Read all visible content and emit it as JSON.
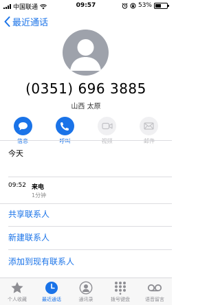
{
  "status_bar": {
    "carrier": "中国联通",
    "time": "09:57",
    "battery": "53%",
    "battery_level": 0.53
  },
  "nav": {
    "back_label": "最近通话"
  },
  "contact": {
    "phone_number": "(0351) 696 3885",
    "location": "山西 太原"
  },
  "actions": [
    {
      "label": "信息",
      "icon": "message-icon",
      "enabled": true
    },
    {
      "label": "呼叫",
      "icon": "phone-icon",
      "enabled": true
    },
    {
      "label": "视频",
      "icon": "video-icon",
      "enabled": false
    },
    {
      "label": "邮件",
      "icon": "mail-icon",
      "enabled": false
    }
  ],
  "recents": {
    "header": "今天",
    "time": "09:52",
    "type": "来电",
    "duration": "1分钟"
  },
  "options": [
    {
      "label": "共享联系人"
    },
    {
      "label": "新建联系人"
    },
    {
      "label": "添加到现有联系人"
    }
  ],
  "tabs": [
    {
      "label": "个人收藏",
      "icon": "star-icon",
      "selected": false
    },
    {
      "label": "最近通话",
      "icon": "clock-icon",
      "selected": true
    },
    {
      "label": "通讯录",
      "icon": "contacts-icon",
      "selected": false
    },
    {
      "label": "拨号键盘",
      "icon": "keypad-icon",
      "selected": false
    },
    {
      "label": "语音留言",
      "icon": "voicemail-icon",
      "selected": false
    }
  ],
  "colors": {
    "accent": "#1a73e8",
    "avatar": "#9ea2ab",
    "disabled": "#f0f0f2"
  }
}
